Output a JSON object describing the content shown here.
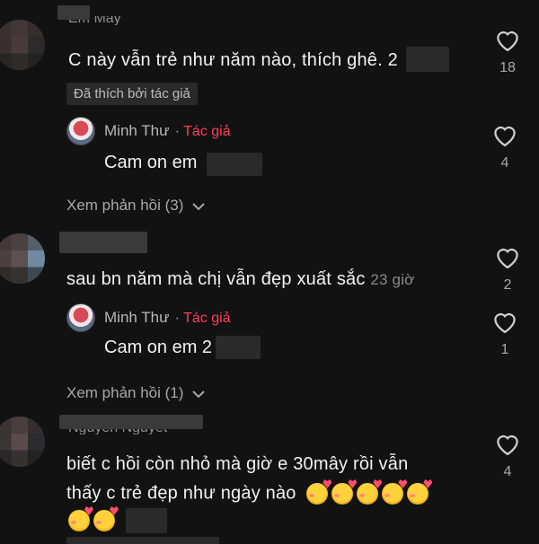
{
  "comments": [
    {
      "username": "Em May",
      "text": "C này vẫn trẻ như năm nào, thích ghê. 2",
      "liked_by_author": "Đã thích bởi tác giả",
      "likes": "18",
      "reply": {
        "name": "Minh Thư",
        "tag": "Tác giả",
        "text": "Cam on em",
        "likes": "4"
      },
      "view_replies": "Xem phản hồi (3)"
    },
    {
      "text": "sau bn năm mà chị vẫn đẹp xuất sắc",
      "time": "23 giờ",
      "likes": "2",
      "reply": {
        "name": "Minh Thư",
        "tag": "Tác giả",
        "text": "Cam on em 2",
        "likes": "1"
      },
      "view_replies": "Xem phản hồi (1)"
    },
    {
      "username": "Nguyen Nguyet",
      "text_line1": "biết c hồi còn nhỏ mà giờ e 30mây rồi vẫn",
      "text_line2": "thấy c trẻ đẹp như ngày nào",
      "likes": "4"
    }
  ],
  "icons": {
    "like": "heart-outline-icon",
    "chevron": "chevron-down-icon"
  },
  "colors": {
    "background": "#121212",
    "author_tag": "#ff3d5a",
    "muted": "#a8a8a8"
  }
}
